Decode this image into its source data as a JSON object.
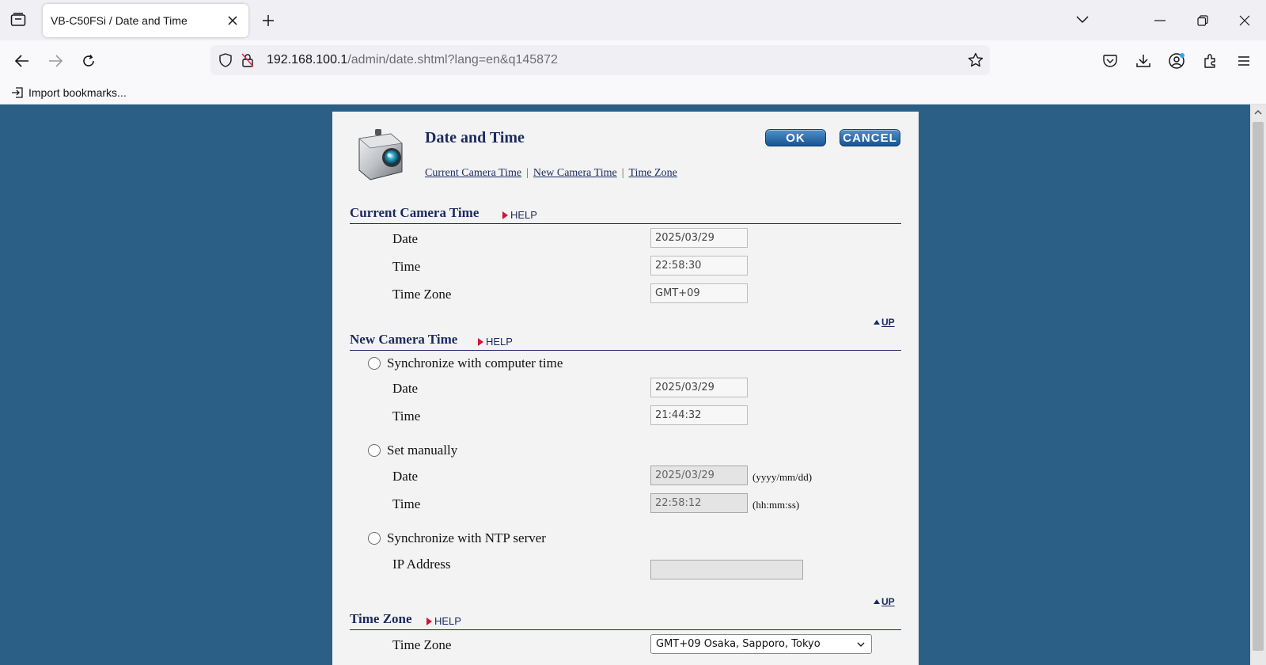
{
  "browser": {
    "tab_title": "VB-C50FSi / Date and Time",
    "url_host": "192.168.100.1",
    "url_path": "/admin/date.shtml?lang=en&q145872",
    "bookmark_label": "Import bookmarks..."
  },
  "page": {
    "title": "Date and Time",
    "ok_label": "OK",
    "cancel_label": "CANCEL",
    "anchors": [
      "Current Camera Time",
      "New Camera Time",
      "Time Zone"
    ],
    "help_label": "HELP",
    "up_label": "UP"
  },
  "current_time": {
    "heading": "Current Camera Time",
    "date_label": "Date",
    "date_value": "2025/03/29",
    "time_label": "Time",
    "time_value": "22:58:30",
    "tz_label": "Time Zone",
    "tz_value": "GMT+09"
  },
  "new_time": {
    "heading": "New Camera Time",
    "sync_computer_label": "Synchronize with computer time",
    "computer_date_label": "Date",
    "computer_date_value": "2025/03/29",
    "computer_time_label": "Time",
    "computer_time_value": "21:44:32",
    "manual_label": "Set manually",
    "manual_date_label": "Date",
    "manual_date_value": "2025/03/29",
    "manual_date_hint": "(yyyy/mm/dd)",
    "manual_time_label": "Time",
    "manual_time_value": "22:58:12",
    "manual_time_hint": "(hh:mm:ss)",
    "ntp_label": "Synchronize with NTP server",
    "ip_label": "IP Address",
    "ip_value": ""
  },
  "time_zone": {
    "heading": "Time Zone",
    "label": "Time Zone",
    "selected": "GMT+09 Osaka, Sapporo, Tokyo"
  },
  "colors": {
    "page_background": "#2b5f86",
    "heading": "#1b2a5e",
    "help_arrow": "#d2143a",
    "button": "#18558f"
  }
}
